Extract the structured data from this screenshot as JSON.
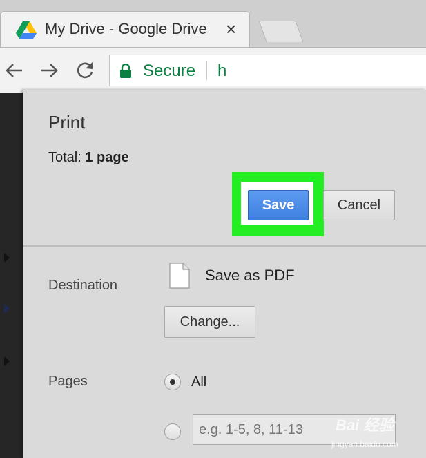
{
  "browser": {
    "tab": {
      "title": "My Drive - Google Drive",
      "close_glyph": "×",
      "favicon": "google-drive-icon"
    },
    "nav": {
      "back_icon": "back-arrow-icon",
      "forward_icon": "forward-arrow-icon",
      "reload_icon": "reload-icon"
    },
    "omnibox": {
      "lock_icon": "lock-icon",
      "secure_label": "Secure",
      "url_visible": "h"
    }
  },
  "print_dialog": {
    "title": "Print",
    "total_label": "Total:",
    "total_value": "1 page",
    "save_label": "Save",
    "cancel_label": "Cancel",
    "destination_label": "Destination",
    "destination_value": "Save as PDF",
    "destination_icon": "document-icon",
    "change_label": "Change...",
    "pages_label": "Pages",
    "pages_all_label": "All",
    "pages_all_selected": true,
    "pages_custom_placeholder": "e.g. 1-5, 8, 11-13"
  },
  "colors": {
    "save_button": "#4a8af4",
    "highlight": "#22ee22",
    "secure_green": "#0b8043"
  },
  "watermark": {
    "logo": "Bai 经验",
    "site": "jingyan.baidu.com"
  }
}
